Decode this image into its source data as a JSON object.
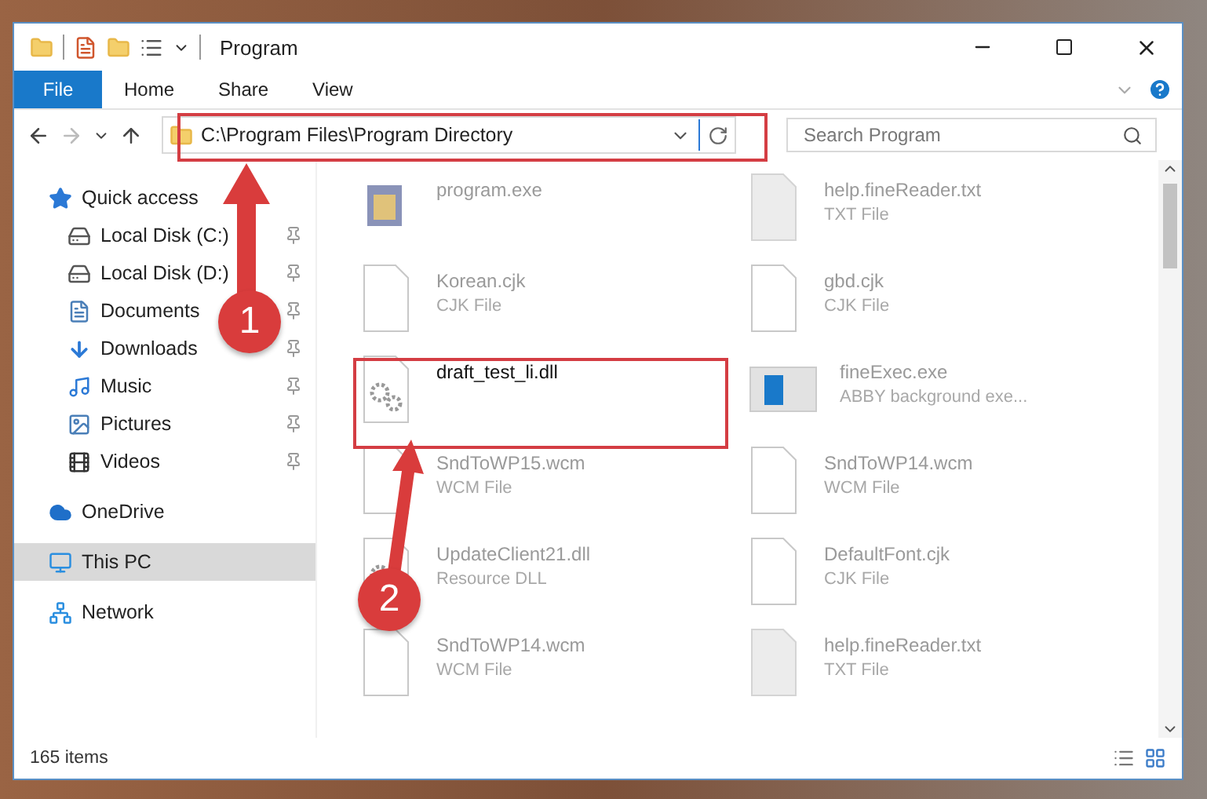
{
  "window": {
    "title": "Program"
  },
  "ribbon_tabs": [
    {
      "label": "File",
      "selected": true
    },
    {
      "label": "Home",
      "selected": false
    },
    {
      "label": "Share",
      "selected": false
    },
    {
      "label": "View",
      "selected": false
    }
  ],
  "address": {
    "path": "C:\\Program Files\\Program Directory"
  },
  "search": {
    "placeholder": "Search Program"
  },
  "sidebar": {
    "items": [
      {
        "label": "Quick access",
        "kind": "star",
        "selected": false,
        "children": [
          {
            "label": "Local Disk (C:)",
            "kind": "drive",
            "pinned": true,
            "selected": false
          },
          {
            "label": "Local Disk (D:)",
            "kind": "drive",
            "pinned": true,
            "selected": false
          },
          {
            "label": "Documents",
            "kind": "documents",
            "pinned": true,
            "selected": false
          },
          {
            "label": "Downloads",
            "kind": "downloads",
            "pinned": true,
            "selected": false
          },
          {
            "label": "Music",
            "kind": "music",
            "pinned": true,
            "selected": false
          },
          {
            "label": "Pictures",
            "kind": "pictures",
            "pinned": true,
            "selected": false
          },
          {
            "label": "Videos",
            "kind": "videos",
            "pinned": true,
            "selected": false
          }
        ]
      },
      {
        "label": "OneDrive",
        "kind": "cloud",
        "selected": false
      },
      {
        "label": "This PC",
        "kind": "pc",
        "selected": true
      },
      {
        "label": "Network",
        "kind": "network",
        "selected": false
      }
    ]
  },
  "files": [
    {
      "name": "program.exe",
      "kind": "exe",
      "dimmed": true
    },
    {
      "name": "help.fineReader.txt",
      "type": "TXT File",
      "kind": "txt",
      "dimmed": true
    },
    {
      "name": "Korean.cjk",
      "type": "CJK File",
      "kind": "blank",
      "dimmed": true
    },
    {
      "name": "gbd.cjk",
      "type": "CJK File",
      "kind": "blank",
      "dimmed": true
    },
    {
      "name": "draft_test_li.dll",
      "kind": "dll",
      "dimmed": false
    },
    {
      "name": "fineExec.exe",
      "type": "ABBY background exe...",
      "kind": "app",
      "dimmed": true
    },
    {
      "name": "SndToWP15.wcm",
      "type": "WCM File",
      "kind": "blank",
      "dimmed": true
    },
    {
      "name": "SndToWP14.wcm",
      "type": "WCM File",
      "kind": "blank",
      "dimmed": true
    },
    {
      "name": "UpdateClient21.dll",
      "type": "Resource DLL",
      "kind": "dll",
      "dimmed": true
    },
    {
      "name": "DefaultFont.cjk",
      "type": "CJK File",
      "kind": "blank",
      "dimmed": true
    },
    {
      "name": "SndToWP14.wcm",
      "type": "WCM File",
      "kind": "blank",
      "dimmed": true
    },
    {
      "name": "help.fineReader.txt",
      "type": "TXT File",
      "kind": "txt",
      "dimmed": true
    }
  ],
  "status_bar": {
    "count": "165 items"
  },
  "annotations": [
    {
      "label": "1"
    },
    {
      "label": "2"
    }
  ]
}
